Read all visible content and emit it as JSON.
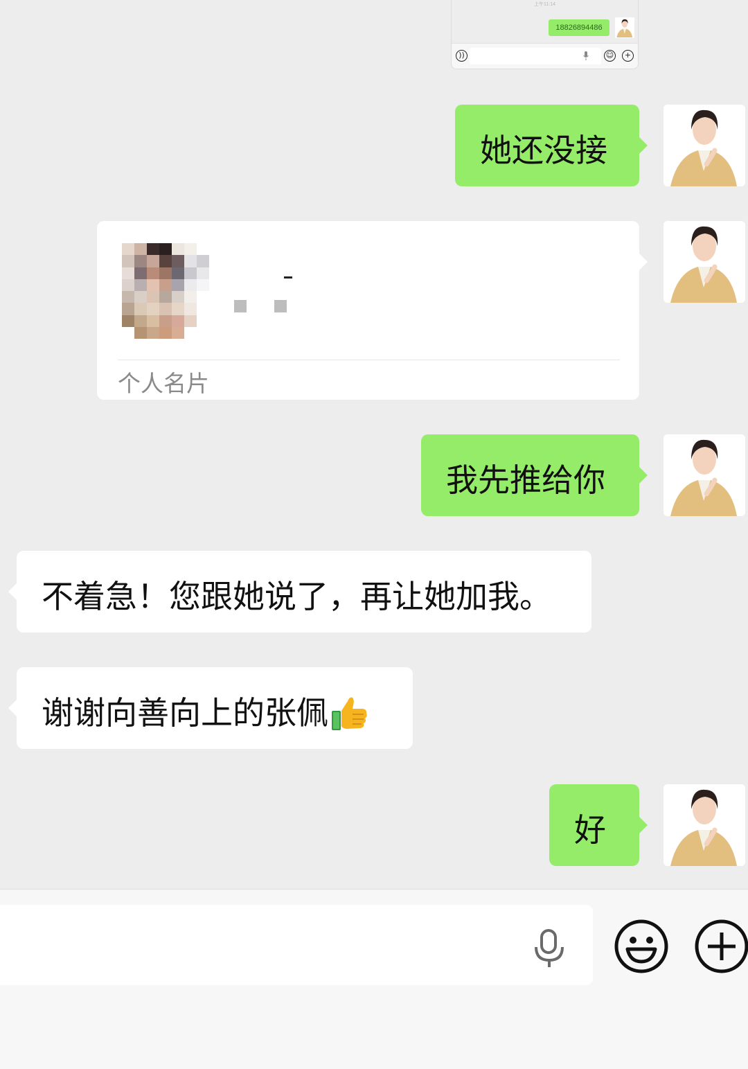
{
  "embedded_screenshot": {
    "time": "上午11:14",
    "bubble_text": "18826894486"
  },
  "messages": [
    {
      "sender": "me",
      "text": "她还没接"
    },
    {
      "sender": "me",
      "type": "contact_card",
      "label": "个人名片"
    },
    {
      "sender": "me",
      "text": "我先推给你"
    },
    {
      "sender": "other",
      "text": "不着急！您跟她说了，再让她加我。"
    },
    {
      "sender": "other",
      "text": "谢谢向善向上的张佩",
      "emoji": "thumbs-up-icon"
    },
    {
      "sender": "me",
      "text": "好"
    }
  ],
  "input_bar": {
    "icons": [
      "voice-input-icon",
      "emoji-icon",
      "plus-icon"
    ]
  },
  "colors": {
    "background": "#ededed",
    "my_bubble": "#95ec69",
    "other_bubble": "#ffffff",
    "card_label": "#8a8a8a"
  }
}
